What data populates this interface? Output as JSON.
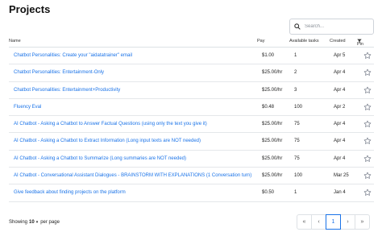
{
  "page": {
    "title": "Projects"
  },
  "search": {
    "placeholder": "Search..."
  },
  "table": {
    "headers": {
      "name": "Name",
      "pay": "Pay",
      "tasks": "Available tasks",
      "created": "Created",
      "pin": "Pin"
    },
    "rows": [
      {
        "name": "Chatbot Personalities: Create your \"aidatatrainer\" email",
        "pay": "$1.00",
        "tasks": "1",
        "created": "Apr 5"
      },
      {
        "name": "Chatbot Personalities: Entertainment-Only",
        "pay": "$25.00/hr",
        "tasks": "2",
        "created": "Apr 4"
      },
      {
        "name": "Chatbot Personalities: Entertainment+Productivity",
        "pay": "$25.00/hr",
        "tasks": "3",
        "created": "Apr 4"
      },
      {
        "name": "Fluency Eval",
        "pay": "$0.48",
        "tasks": "100",
        "created": "Apr 2"
      },
      {
        "name": "AI Chatbot - Asking a Chatbot to Answer Factual Questions (using only the text you give it)",
        "pay": "$25.00/hr",
        "tasks": "75",
        "created": "Apr 4"
      },
      {
        "name": "AI Chatbot - Asking a Chatbot to Extract Information (Long input texts are NOT needed)",
        "pay": "$25.00/hr",
        "tasks": "75",
        "created": "Apr 4"
      },
      {
        "name": "AI Chatbot - Asking a Chatbot to Summarize (Long summaries are NOT needed)",
        "pay": "$25.00/hr",
        "tasks": "75",
        "created": "Apr 4"
      },
      {
        "name": "AI Chatbot - Conversational Assistant Dialogues - BRAINSTORM WITH EXPLANATIONS (1 Conversation turn)",
        "pay": "$25.00/hr",
        "tasks": "100",
        "created": "Mar 25"
      },
      {
        "name": "Give feedback about finding projects on the platform",
        "pay": "$0.50",
        "tasks": "1",
        "created": "Jan 4"
      }
    ]
  },
  "footer": {
    "showing_label": "Showing",
    "per_page_value": "10",
    "caret": "▾",
    "per_page_label": "per page"
  },
  "pagination": {
    "first": "«",
    "prev": "‹",
    "current": "1",
    "next": "›",
    "last": "»"
  },
  "icons": {
    "search": "search-icon",
    "filter": "filter-icon",
    "star": "star-outline-icon"
  },
  "colors": {
    "link": "#1a73e8",
    "border": "#dde1e5",
    "star": "#6b7280"
  }
}
